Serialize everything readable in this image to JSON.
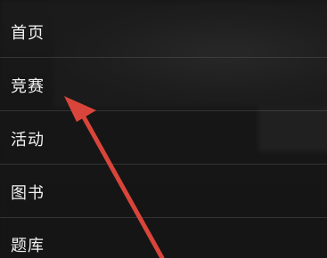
{
  "menu": {
    "items": [
      {
        "label": "首页"
      },
      {
        "label": "竞赛"
      },
      {
        "label": "活动"
      },
      {
        "label": "图书"
      },
      {
        "label": "题库"
      }
    ]
  },
  "annotation": {
    "arrow_color": "#d9453a",
    "points_to": "竞赛"
  },
  "colors": {
    "background": "#141414",
    "menu_text": "#f2f2f2",
    "divider": "#5a5a5a"
  }
}
